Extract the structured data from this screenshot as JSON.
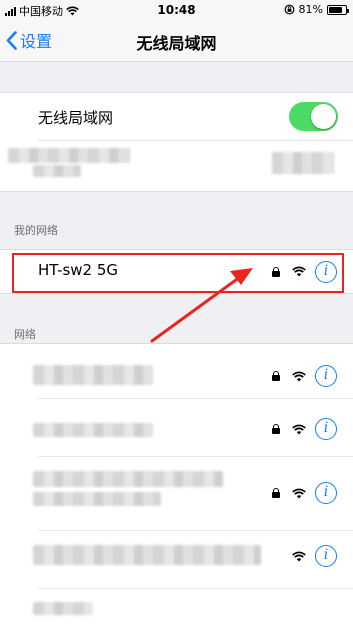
{
  "status_bar": {
    "carrier": "中国移动",
    "time": "10:48",
    "battery": "81%",
    "battery_level": 0.81
  },
  "nav": {
    "back_label": "设置",
    "title": "无线局域网"
  },
  "wifi": {
    "label": "无线局域网",
    "enabled": true,
    "toggle_color": "#4cd964"
  },
  "my_networks": {
    "header": "我的网络",
    "items": [
      {
        "name": "HT-sw2 5G",
        "locked": true,
        "icons": [
          "lock-icon",
          "wifi-icon",
          "info-icon"
        ]
      }
    ]
  },
  "networks": {
    "header": "网络",
    "items": [
      {
        "locked": true
      },
      {
        "locked": true
      },
      {
        "locked": true
      },
      {
        "locked": false
      }
    ]
  },
  "annotation": {
    "color": "#e8251e"
  },
  "accent_color": "#147efb"
}
